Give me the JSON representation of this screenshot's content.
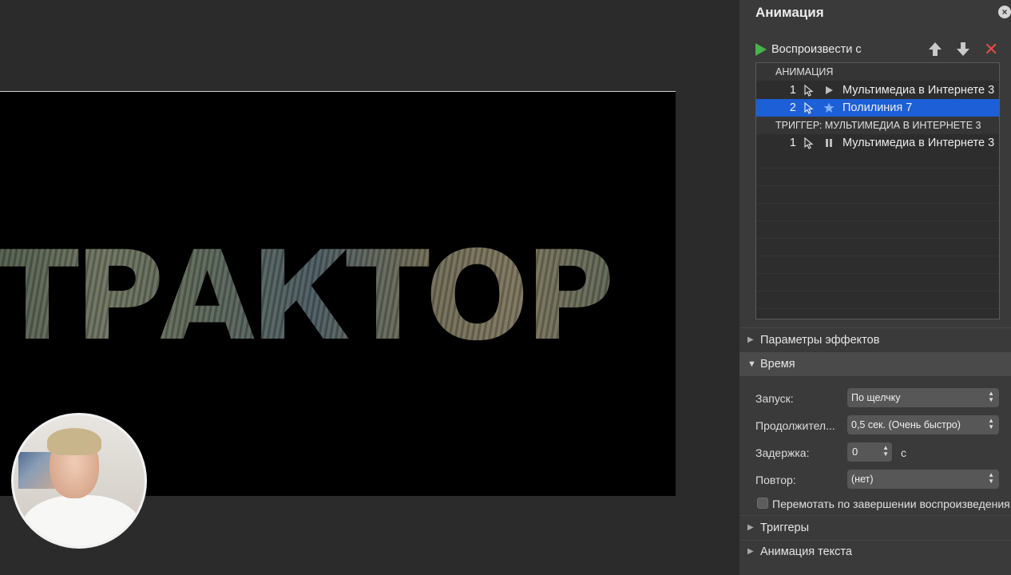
{
  "slide": {
    "word": "ТРАКТОР"
  },
  "panel": {
    "title": "Анимация",
    "play_label": "Воспроизвести с",
    "list": {
      "group1_title": "АНИМАЦИЯ",
      "group2_title": "ТРИГГЕР: МУЛЬТИМЕДИА В ИНТЕРНЕТЕ 3",
      "items": [
        {
          "num": "1",
          "type_icon": "play-icon",
          "label": "Мультимедиа в Интернете 3"
        },
        {
          "num": "2",
          "type_icon": "star-icon",
          "label": "Полилиния 7",
          "selected": true
        },
        {
          "num": "1",
          "type_icon": "pause-icon",
          "label": "Мультимедиа в Интернете 3"
        }
      ]
    },
    "sections": {
      "effect_params": "Параметры эффектов",
      "timing": "Время",
      "triggers": "Триггеры",
      "text_animation": "Анимация текста"
    },
    "timing": {
      "start_label": "Запуск:",
      "start_value": "По щелчку",
      "duration_label": "Продолжител...",
      "duration_value": "0,5 сек. (Очень быстро)",
      "delay_label": "Задержка:",
      "delay_value": "0",
      "delay_unit": "с",
      "repeat_label": "Повтор:",
      "repeat_value": "(нет)",
      "rewind_label": "Перемотать по завершении воспроизведения"
    }
  },
  "colors": {
    "selection": "#1c5fd6",
    "play_green": "#46b44a",
    "delete_red": "#e34b45"
  }
}
